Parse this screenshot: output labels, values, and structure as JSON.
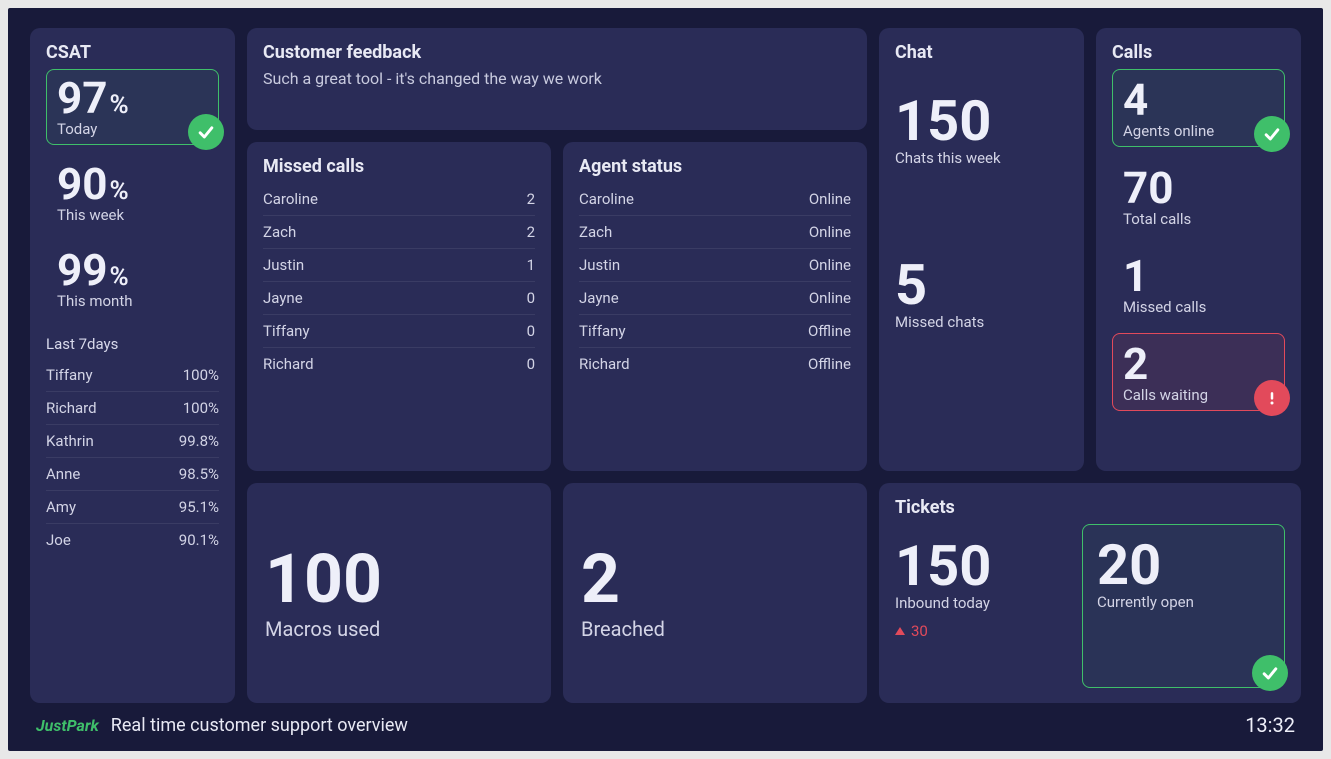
{
  "csat": {
    "title": "CSAT",
    "today": {
      "value": "97",
      "unit": "%",
      "label": "Today",
      "status": "ok"
    },
    "week": {
      "value": "90",
      "unit": "%",
      "label": "This week"
    },
    "month": {
      "value": "99",
      "unit": "%",
      "label": "This month"
    },
    "last7_label": "Last 7days",
    "last7": [
      {
        "name": "Tiffany",
        "value": "100%"
      },
      {
        "name": "Richard",
        "value": "100%"
      },
      {
        "name": "Kathrin",
        "value": "99.8%"
      },
      {
        "name": "Anne",
        "value": "98.5%"
      },
      {
        "name": "Amy",
        "value": "95.1%"
      },
      {
        "name": "Joe",
        "value": "90.1%"
      }
    ]
  },
  "feedback": {
    "title": "Customer feedback",
    "body": "Such a great tool - it's changed the way we work"
  },
  "missed_calls": {
    "title": "Missed calls",
    "rows": [
      {
        "name": "Caroline",
        "value": "2"
      },
      {
        "name": "Zach",
        "value": "2"
      },
      {
        "name": "Justin",
        "value": "1"
      },
      {
        "name": "Jayne",
        "value": "0"
      },
      {
        "name": "Tiffany",
        "value": "0"
      },
      {
        "name": "Richard",
        "value": "0"
      }
    ]
  },
  "agent_status": {
    "title": "Agent status",
    "rows": [
      {
        "name": "Caroline",
        "value": "Online"
      },
      {
        "name": "Zach",
        "value": "Online"
      },
      {
        "name": "Justin",
        "value": "Online"
      },
      {
        "name": "Jayne",
        "value": "Online"
      },
      {
        "name": "Tiffany",
        "value": "Offline"
      },
      {
        "name": "Richard",
        "value": "Offline"
      }
    ]
  },
  "macros": {
    "value": "100",
    "label": "Macros used"
  },
  "breached": {
    "value": "2",
    "label": "Breached"
  },
  "chat": {
    "title": "Chat",
    "week": {
      "value": "150",
      "label": "Chats this week"
    },
    "missed": {
      "value": "5",
      "label": "Missed chats"
    }
  },
  "calls": {
    "title": "Calls",
    "agents": {
      "value": "4",
      "label": "Agents online",
      "status": "ok"
    },
    "total": {
      "value": "70",
      "label": "Total calls"
    },
    "missed": {
      "value": "1",
      "label": "Missed calls"
    },
    "waiting": {
      "value": "2",
      "label": "Calls waiting",
      "status": "warn"
    }
  },
  "tickets": {
    "title": "Tickets",
    "inbound": {
      "value": "150",
      "label": "Inbound today",
      "delta": "30"
    },
    "open": {
      "value": "20",
      "label": "Currently open",
      "status": "ok"
    }
  },
  "footer": {
    "brand": "JustPark",
    "title": "Real time customer support overview",
    "clock": "13:32"
  }
}
